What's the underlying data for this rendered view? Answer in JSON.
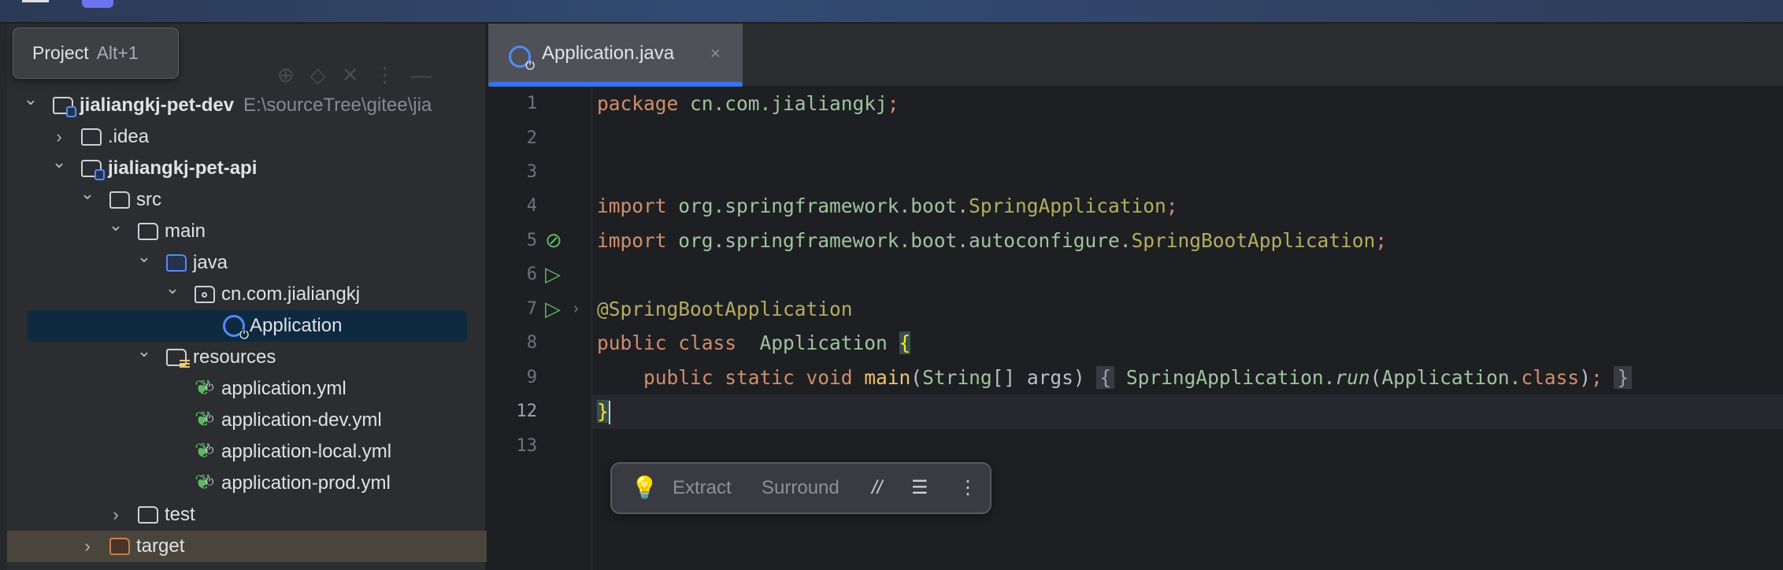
{
  "tooltip": {
    "label": "Project",
    "shortcut": "Alt+1"
  },
  "tree": [
    {
      "label": "jialiangkj-pet-dev",
      "path": "E:\\sourceTree\\gitee\\jia",
      "level": 0,
      "chevron": "down",
      "icon": "module-folder",
      "bold": true
    },
    {
      "label": ".idea",
      "level": 1,
      "chevron": "right",
      "icon": "folder"
    },
    {
      "label": "jialiangkj-pet-api",
      "level": 1,
      "chevron": "down",
      "icon": "module-folder",
      "bold": true
    },
    {
      "label": "src",
      "level": 2,
      "chevron": "down",
      "icon": "folder"
    },
    {
      "label": "main",
      "level": 3,
      "chevron": "down",
      "icon": "folder"
    },
    {
      "label": "java",
      "level": 4,
      "chevron": "down",
      "icon": "source-folder"
    },
    {
      "label": "cn.com.jialiangkj",
      "level": 5,
      "chevron": "down",
      "icon": "package"
    },
    {
      "label": "Application",
      "level": 6,
      "icon": "spring-boot-class",
      "selected": true
    },
    {
      "label": "resources",
      "level": 4,
      "chevron": "down",
      "icon": "resources-folder"
    },
    {
      "label": "application.yml",
      "level": 5,
      "icon": "spring-config"
    },
    {
      "label": "application-dev.yml",
      "level": 5,
      "icon": "spring-config"
    },
    {
      "label": "application-local.yml",
      "level": 5,
      "icon": "spring-config"
    },
    {
      "label": "application-prod.yml",
      "level": 5,
      "icon": "spring-config"
    },
    {
      "label": "test",
      "level": 3,
      "chevron": "right",
      "icon": "folder"
    },
    {
      "label": "target",
      "level": 2,
      "chevron": "right",
      "icon": "excluded-folder",
      "highlighted": true
    }
  ],
  "editor": {
    "tab": {
      "label": "Application.java",
      "close": "×"
    },
    "line_numbers": [
      "1",
      "2",
      "3",
      "4",
      "5",
      "6",
      "7",
      "8",
      "9",
      "12",
      "13"
    ],
    "current_line": "12",
    "code": {
      "l1": {
        "kw": "package",
        "pkg": " cn.com.jialiangkj",
        "semi": ";"
      },
      "l4": {
        "kw": "import",
        "pkg": " org.springframework.boot.",
        "cls": "SpringApplication",
        "semi": ";"
      },
      "l5": {
        "kw": "import",
        "pkg": " org.springframework.boot.autoconfigure.",
        "cls": "SpringBootApplication",
        "semi": ";"
      },
      "l7": {
        "ann": "@SpringBootApplication"
      },
      "l8": {
        "kw": "public class ",
        "cls": " Application ",
        "brace": "{"
      },
      "l9": {
        "indent": "    ",
        "kw": "public static void ",
        "fn": "main",
        "p1": "(",
        "type": "String",
        "p2": "[] args) ",
        "ob": "{",
        "sp": " SpringApplication.",
        "run": "run",
        "p3": "(",
        "cls": "Application.",
        "kw2": "class",
        "p4": ")",
        "semi": ";",
        "cb": "}"
      },
      "l12": {
        "brace": "}"
      }
    },
    "colors": {
      "keyword": "#cf8e6d",
      "package": "#9ec4a0",
      "annotation": "#b3ae60",
      "function": "#f0c46f",
      "brace_match": "#fde234",
      "accent": "#3574f0"
    }
  },
  "popup": {
    "icon": "lightbulb-icon",
    "extract": "Extract",
    "surround": "Surround",
    "comment": "//",
    "more": "⋮"
  }
}
